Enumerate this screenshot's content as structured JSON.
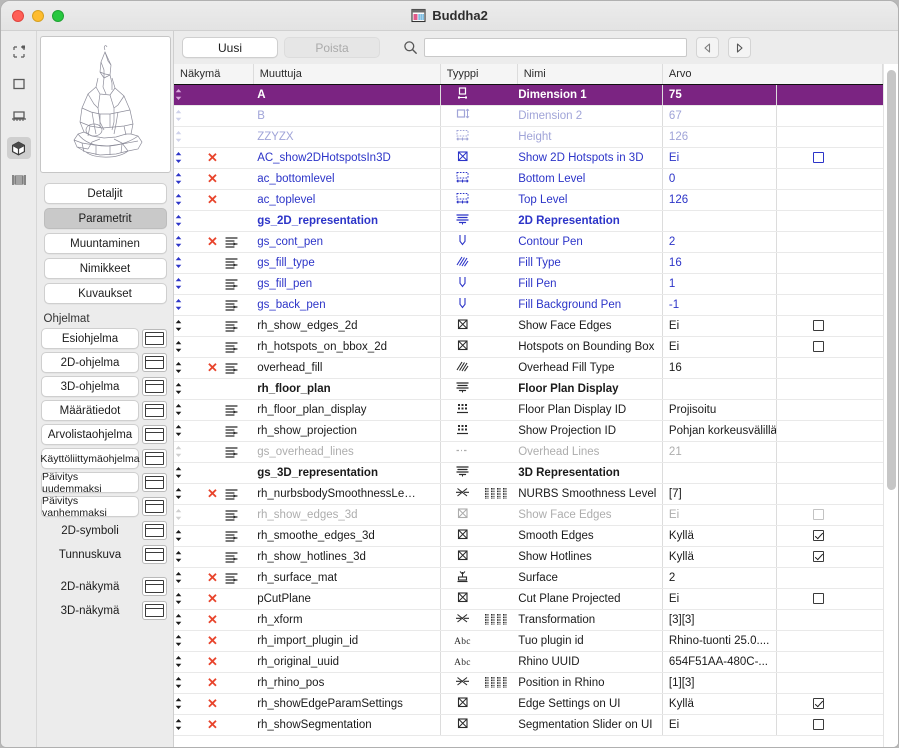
{
  "window": {
    "title": "Buddha2",
    "doc_icon": "document-properties-icon"
  },
  "toolstrip": {
    "items": [
      {
        "name": "selection-tool-icon",
        "active": false
      },
      {
        "name": "rectangle-tool-icon",
        "active": false
      },
      {
        "name": "floor-plan-tool-icon",
        "active": false
      },
      {
        "name": "3d-model-tool-icon",
        "active": true
      },
      {
        "name": "section-tool-icon",
        "active": false
      }
    ]
  },
  "left_panel": {
    "tabs": [
      {
        "label": "Detaljit",
        "selected": false
      },
      {
        "label": "Parametrit",
        "selected": true
      },
      {
        "label": "Muuntaminen",
        "selected": false
      },
      {
        "label": "Nimikkeet",
        "selected": false
      },
      {
        "label": "Kuvaukset",
        "selected": false
      }
    ],
    "section_label": "Ohjelmat",
    "scripts": [
      {
        "label": "Esiohjelma",
        "boxed": true,
        "framed": true
      },
      {
        "label": "2D-ohjelma",
        "boxed": true,
        "framed": true
      },
      {
        "label": "3D-ohjelma",
        "boxed": true,
        "framed": true
      },
      {
        "label": "Määrätiedot",
        "boxed": true,
        "framed": true
      },
      {
        "label": "Arvolistaohjelma",
        "boxed": true,
        "framed": true
      },
      {
        "label": "Käyttöliittymäohjelma",
        "boxed": true,
        "framed": true
      },
      {
        "label": "Päivitys uudemmaksi",
        "boxed": true,
        "framed": true
      },
      {
        "label": "Päivitys vanhemmaksi",
        "boxed": true,
        "framed": true
      },
      {
        "label": "2D-symboli",
        "boxed": false,
        "framed": true
      },
      {
        "label": "Tunnuskuva",
        "boxed": false,
        "framed": true
      },
      {
        "label": "2D-näkymä",
        "boxed": false,
        "framed": true,
        "gap_before": true
      },
      {
        "label": "3D-näkymä",
        "boxed": false,
        "framed": true
      }
    ]
  },
  "toolbar": {
    "new_label": "Uusi",
    "delete_label": "Poista",
    "search_value": "",
    "search_placeholder": "",
    "prev_label": "◁",
    "next_label": "▷"
  },
  "table": {
    "headers": {
      "view": "Näkymä",
      "variable": "Muuttuja",
      "type": "Tyyppi",
      "name": "Nimi",
      "value": "Arvo"
    },
    "rows": [
      {
        "variable": "A",
        "type": "dimension1-icon",
        "name": "Dimension 1",
        "value": "75",
        "style": "selected",
        "handle": "dim",
        "x": false,
        "lock": false,
        "arr": false,
        "bold": true,
        "check": null
      },
      {
        "variable": "B",
        "type": "dimension2-icon",
        "name": "Dimension 2",
        "value": "67",
        "style": "dim",
        "handle": "dim",
        "x": false,
        "lock": false,
        "arr": false,
        "bold": false,
        "check": null
      },
      {
        "variable": "ZZYZX",
        "type": "height-icon",
        "name": "Height",
        "value": "126",
        "style": "dim",
        "handle": "dim",
        "x": false,
        "lock": false,
        "arr": false,
        "bold": false,
        "check": null
      },
      {
        "variable": "AC_show2DHotspotsIn3D",
        "type": "checkbox-type-icon",
        "name": "Show 2D Hotspots in 3D",
        "value": "Ei",
        "style": "blue",
        "handle": "blue",
        "x": true,
        "lock": false,
        "arr": false,
        "bold": false,
        "check": "off-blue"
      },
      {
        "variable": "ac_bottomlevel",
        "type": "height-icon",
        "name": "Bottom Level",
        "value": "0",
        "style": "blue",
        "handle": "blue",
        "x": true,
        "lock": false,
        "arr": false,
        "bold": false,
        "check": null
      },
      {
        "variable": "ac_toplevel",
        "type": "height-icon",
        "name": "Top Level",
        "value": "126",
        "style": "blue",
        "handle": "blue",
        "x": true,
        "lock": false,
        "arr": false,
        "bold": false,
        "check": null
      },
      {
        "variable": "gs_2D_representation",
        "type": "group-title-icon",
        "name": "2D Representation",
        "value": "",
        "style": "blue",
        "handle": "blue",
        "x": false,
        "lock": false,
        "arr": false,
        "bold": true,
        "check": null
      },
      {
        "variable": "gs_cont_pen",
        "type": "pen-icon",
        "name": "Contour Pen",
        "value": "2",
        "style": "blue",
        "handle": "blue",
        "x": true,
        "lock": true,
        "arr": false,
        "bold": false,
        "check": null
      },
      {
        "variable": "gs_fill_type",
        "type": "fill-icon",
        "name": "Fill Type",
        "value": "16",
        "style": "blue",
        "handle": "blue",
        "x": false,
        "lock": true,
        "arr": false,
        "bold": false,
        "check": null
      },
      {
        "variable": "gs_fill_pen",
        "type": "pen-icon",
        "name": "Fill Pen",
        "value": "1",
        "style": "blue",
        "handle": "blue",
        "x": false,
        "lock": true,
        "arr": false,
        "bold": false,
        "check": null
      },
      {
        "variable": "gs_back_pen",
        "type": "pen-icon",
        "name": "Fill Background Pen",
        "value": "-1",
        "style": "blue",
        "handle": "blue",
        "x": false,
        "lock": true,
        "arr": false,
        "bold": false,
        "check": null
      },
      {
        "variable": "rh_show_edges_2d",
        "type": "checkbox-type-icon",
        "name": "Show Face Edges",
        "value": "Ei",
        "style": "black",
        "handle": "black",
        "x": false,
        "lock": true,
        "arr": false,
        "bold": false,
        "check": "off"
      },
      {
        "variable": "rh_hotspots_on_bbox_2d",
        "type": "checkbox-type-icon",
        "name": "Hotspots on Bounding Box",
        "value": "Ei",
        "style": "black",
        "handle": "black",
        "x": false,
        "lock": true,
        "arr": false,
        "bold": false,
        "check": "off"
      },
      {
        "variable": "overhead_fill",
        "type": "fill-icon",
        "name": "Overhead Fill Type",
        "value": "16",
        "style": "black",
        "handle": "black",
        "x": true,
        "lock": true,
        "arr": false,
        "bold": false,
        "check": null
      },
      {
        "variable": "rh_floor_plan",
        "type": "group-title-icon",
        "name": "Floor Plan Display",
        "value": "",
        "style": "black",
        "handle": "black",
        "x": false,
        "lock": false,
        "arr": false,
        "bold": true,
        "check": null
      },
      {
        "variable": "rh_floor_plan_display",
        "type": "list-icon",
        "name": "Floor Plan Display ID",
        "value": "Projisoitu",
        "style": "black",
        "handle": "black",
        "x": false,
        "lock": true,
        "arr": false,
        "bold": false,
        "check": null
      },
      {
        "variable": "rh_show_projection",
        "type": "list-icon",
        "name": "Show Projection ID",
        "value": "Pohjan korkeusvälillä",
        "style": "black",
        "handle": "black",
        "x": false,
        "lock": true,
        "arr": false,
        "bold": false,
        "check": null
      },
      {
        "variable": "gs_overhead_lines",
        "type": "dashline-icon",
        "name": "Overhead Lines",
        "value": "21",
        "style": "dimgray",
        "handle": "dimgray",
        "x": false,
        "lock": true,
        "arr": false,
        "bold": false,
        "check": null
      },
      {
        "variable": "gs_3D_representation",
        "type": "group-title-icon",
        "name": "3D Representation",
        "value": "",
        "style": "black",
        "handle": "black",
        "x": false,
        "lock": false,
        "arr": false,
        "bold": true,
        "check": null
      },
      {
        "variable": "rh_nurbsbodySmoothnessLe…",
        "type": "transform-icon",
        "name": "NURBS Smoothness Level",
        "value": "[7]",
        "style": "black",
        "handle": "black",
        "x": true,
        "lock": true,
        "arr": true,
        "bold": false,
        "check": null
      },
      {
        "variable": "rh_show_edges_3d",
        "type": "checkbox-type-icon",
        "name": "Show Face Edges",
        "value": "Ei",
        "style": "dimgray",
        "handle": "dimgray",
        "x": false,
        "lock": true,
        "arr": false,
        "bold": false,
        "check": "off-gray"
      },
      {
        "variable": "rh_smoothe_edges_3d",
        "type": "checkbox-type-icon",
        "name": "Smooth Edges",
        "value": "Kyllä",
        "style": "black",
        "handle": "black",
        "x": false,
        "lock": true,
        "arr": false,
        "bold": false,
        "check": "on"
      },
      {
        "variable": "rh_show_hotlines_3d",
        "type": "checkbox-type-icon",
        "name": "Show Hotlines",
        "value": "Kyllä",
        "style": "black",
        "handle": "black",
        "x": false,
        "lock": true,
        "arr": false,
        "bold": false,
        "check": "on"
      },
      {
        "variable": "rh_surface_mat",
        "type": "surface-icon",
        "name": "Surface",
        "value": "2",
        "style": "black",
        "handle": "black",
        "x": true,
        "lock": true,
        "arr": false,
        "bold": false,
        "check": null
      },
      {
        "variable": "pCutPlane",
        "type": "checkbox-type-icon",
        "name": "Cut Plane Projected",
        "value": "Ei",
        "style": "black",
        "handle": "black",
        "x": true,
        "lock": false,
        "arr": false,
        "bold": false,
        "check": "off"
      },
      {
        "variable": "rh_xform",
        "type": "transform-icon",
        "name": "Transformation",
        "value": "[3][3]",
        "style": "black",
        "handle": "black",
        "x": true,
        "lock": false,
        "arr": true,
        "bold": false,
        "check": null
      },
      {
        "variable": "rh_import_plugin_id",
        "type": "text-abc-icon",
        "name": "Tuo plugin id",
        "value": "Rhino-tuonti 25.0....",
        "style": "black",
        "handle": "black",
        "x": true,
        "lock": false,
        "arr": false,
        "bold": false,
        "check": null
      },
      {
        "variable": "rh_original_uuid",
        "type": "text-abc-icon",
        "name": "Rhino UUID",
        "value": "654F51AA-480C-...",
        "style": "black",
        "handle": "black",
        "x": true,
        "lock": false,
        "arr": false,
        "bold": false,
        "check": null
      },
      {
        "variable": "rh_rhino_pos",
        "type": "transform-icon",
        "name": "Position in Rhino",
        "value": "[1][3]",
        "style": "black",
        "handle": "black",
        "x": true,
        "lock": false,
        "arr": true,
        "bold": false,
        "check": null
      },
      {
        "variable": "rh_showEdgeParamSettings",
        "type": "checkbox-type-icon",
        "name": "Edge Settings on UI",
        "value": "Kyllä",
        "style": "black",
        "handle": "black",
        "x": true,
        "lock": false,
        "arr": false,
        "bold": false,
        "check": "on"
      },
      {
        "variable": "rh_showSegmentation",
        "type": "checkbox-type-icon",
        "name": "Segmentation Slider on UI",
        "value": "Ei",
        "style": "black",
        "handle": "black",
        "x": true,
        "lock": false,
        "arr": false,
        "bold": false,
        "check": "off"
      }
    ]
  },
  "colors": {
    "selection": "#7b2482",
    "blue_text": "#2c34c8",
    "x_red": "#e8442c"
  }
}
